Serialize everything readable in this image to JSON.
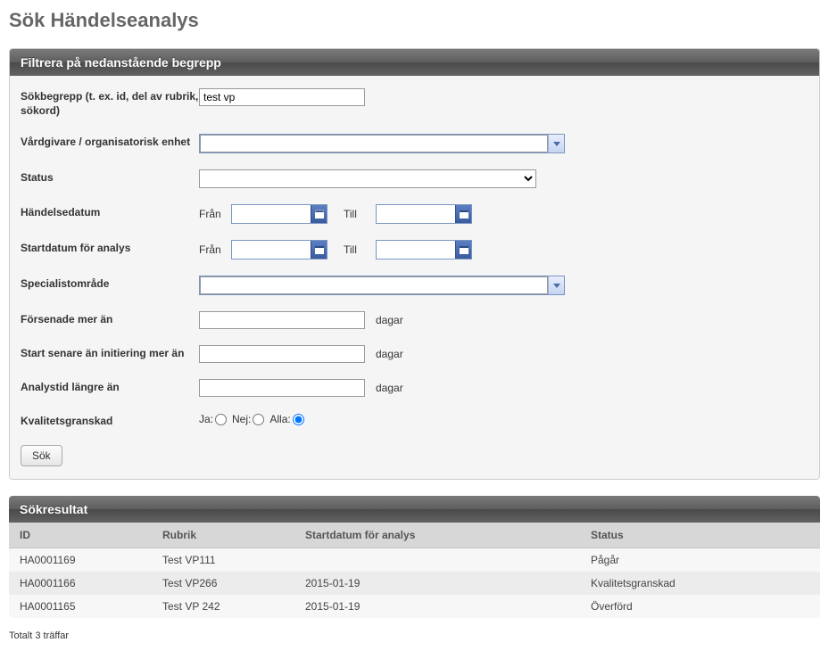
{
  "page": {
    "title": "Sök Händelseanalys"
  },
  "filterPanel": {
    "header": "Filtrera på nedanstående begrepp",
    "fields": {
      "sokbegrepp": {
        "label": "Sökbegrepp (t. ex. id, del av rubrik, sökord)",
        "value": "test vp"
      },
      "vardgivare": {
        "label": "Vårdgivare / organisatorisk enhet",
        "value": ""
      },
      "status": {
        "label": "Status",
        "value": ""
      },
      "handelsedatum": {
        "label": "Händelsedatum",
        "fromLabel": "Från",
        "toLabel": "Till",
        "from": "",
        "to": ""
      },
      "startdatum": {
        "label": "Startdatum för analys",
        "fromLabel": "Från",
        "toLabel": "Till",
        "from": "",
        "to": ""
      },
      "specialist": {
        "label": "Specialistområde",
        "value": ""
      },
      "forsenade": {
        "label": "Försenade mer än",
        "value": "",
        "unit": "dagar"
      },
      "startsenare": {
        "label": "Start senare än initiering mer än",
        "value": "",
        "unit": "dagar"
      },
      "analystid": {
        "label": "Analystid längre än",
        "value": "",
        "unit": "dagar"
      },
      "kvalitet": {
        "label": "Kvalitetsgranskad",
        "options": {
          "ja": "Ja:",
          "nej": "Nej:",
          "alla": "Alla:"
        },
        "selected": "alla"
      }
    },
    "searchButton": "Sök"
  },
  "resultsPanel": {
    "header": "Sökresultat",
    "columns": {
      "id": "ID",
      "rubrik": "Rubrik",
      "start": "Startdatum för analys",
      "status": "Status"
    },
    "rows": [
      {
        "id": "HA0001169",
        "rubrik": "Test VP111",
        "start": "",
        "status": "Pågår"
      },
      {
        "id": "HA0001166",
        "rubrik": "Test VP266",
        "start": "2015-01-19",
        "status": "Kvalitetsgranskad"
      },
      {
        "id": "HA0001165",
        "rubrik": "Test VP 242",
        "start": "2015-01-19",
        "status": "Överförd"
      }
    ]
  },
  "summary": "Totalt 3 träffar"
}
